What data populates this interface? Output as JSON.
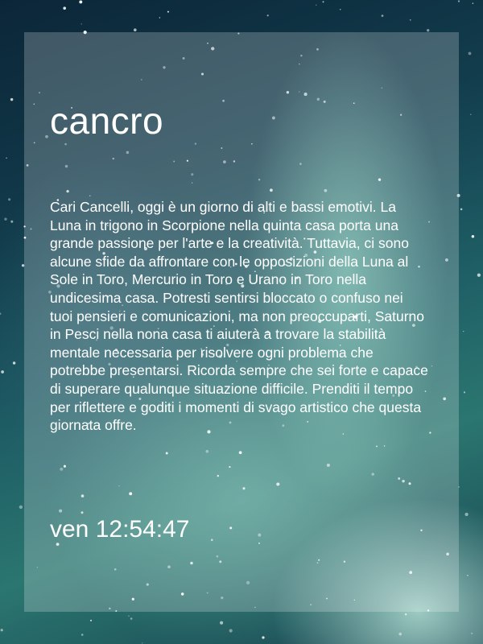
{
  "card": {
    "sign": "cancro",
    "horoscope": "Cari Cancelli, oggi è un giorno di alti e bassi emotivi. La Luna in trigono in Scorpione nella quinta casa porta una grande passione per l'arte e la creatività. Tuttavia, ci sono alcune sfide da affrontare con le opposizioni della Luna al Sole in Toro, Mercurio in Toro e Urano in Toro nella undicesima casa. Potresti sentirsi bloccato o confuso nei tuoi pensieri e comunicazioni, ma non preoccuparti, Saturno in Pesci nella nona casa ti aiuterà a trovare la stabilità mentale necessaria per risolvere ogni problema che potrebbe presentarsi. Ricorda sempre che sei forte e capace di superare qualunque situazione difficile. Prenditi il tempo per riflettere e goditi i momenti di svago artistico che questa giornata offre.",
    "clock": "ven 12:54:47"
  },
  "colors": {
    "card_overlay": "#ffffff",
    "text": "#ffffff",
    "background_dark": "#0b2638",
    "background_glow": "#96e6cd"
  }
}
